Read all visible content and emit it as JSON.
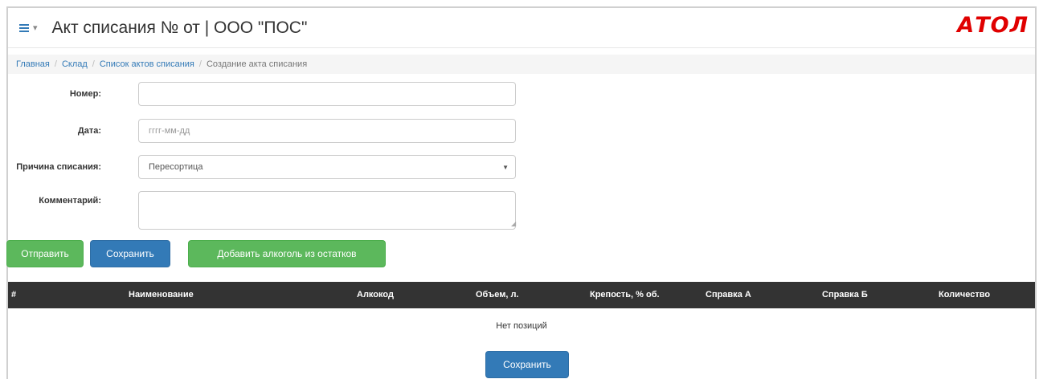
{
  "header": {
    "title": "Акт списания № от | ООО \"ПОС\"",
    "logo_text": "АТОЛ",
    "menu_icon": "hamburger-menu-icon"
  },
  "breadcrumb": [
    {
      "label": "Главная"
    },
    {
      "label": "Склад"
    },
    {
      "label": "Список актов списания"
    },
    {
      "label": "Создание акта списания"
    }
  ],
  "form": {
    "number": {
      "label": "Номер:",
      "value": ""
    },
    "date": {
      "label": "Дата:",
      "placeholder": "гггг-мм-дд"
    },
    "reason": {
      "label": "Причина списания:",
      "selected": "Пересортица"
    },
    "comment": {
      "label": "Комментарий:",
      "value": ""
    }
  },
  "actions": {
    "send_label": "Отправить",
    "save_label": "Сохранить",
    "add_alcohol_label": "Добавить алкоголь из остатков"
  },
  "table": {
    "columns": [
      "#",
      "Наименование",
      "Алкокод",
      "Объем, л.",
      "Крепость, % об.",
      "Справка А",
      "Справка Б",
      "Количество"
    ],
    "empty_text": "Нет позиций"
  },
  "footer": {
    "save_label": "Сохранить"
  },
  "colors": {
    "primary": "#337ab7",
    "success": "#5cb85c",
    "table_header": "#333333",
    "logo": "#e00000"
  }
}
